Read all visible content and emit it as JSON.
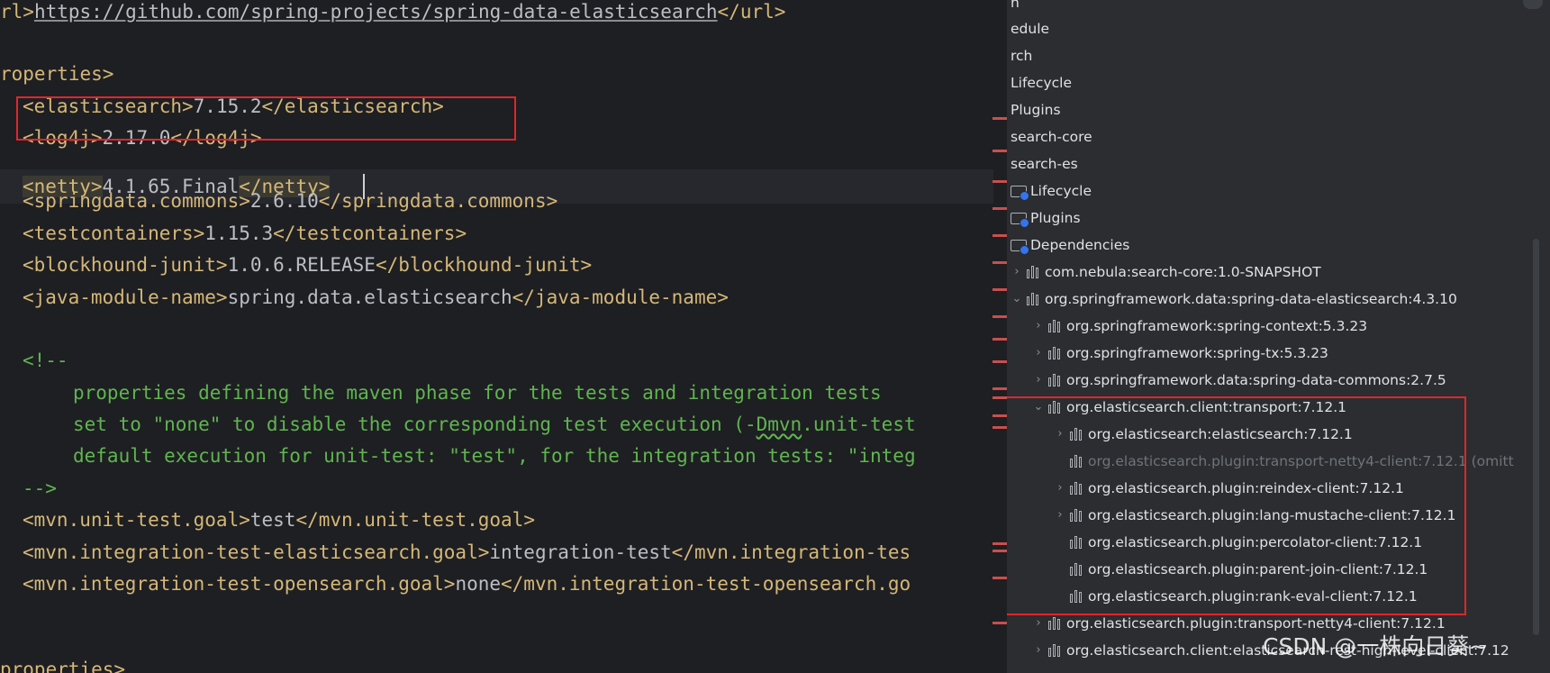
{
  "editor": {
    "line_url": {
      "open": "rl>",
      "url": "https://github.com/spring-projects/spring-data-elasticsearch",
      "close": "</url>"
    },
    "line_properties_open": "roperties>",
    "line_elasticsearch": {
      "open": "<elasticsearch>",
      "value": "7.15.2",
      "close": "</elasticsearch>"
    },
    "line_log4j": {
      "open": "<log4j>",
      "value": "2.17.0",
      "close": "</log4j>"
    },
    "line_netty": {
      "open": "<netty>",
      "value": "4.1.65.Final",
      "close": "</netty>"
    },
    "line_springdata": {
      "open": "<springdata.commons>",
      "value": "2.6.10",
      "close": "</springdata.commons>"
    },
    "line_testcontainers": {
      "open": "<testcontainers>",
      "value": "1.15.3",
      "close": "</testcontainers>"
    },
    "line_blockhound": {
      "open": "<blockhound-junit>",
      "value": "1.0.6.RELEASE",
      "close": "</blockhound-junit>"
    },
    "line_javamodule": {
      "open": "<java-module-name>",
      "value": "spring.data.elasticsearch",
      "close": "</java-module-name>"
    },
    "comment_open": "<!--",
    "comment_1": "properties defining the maven phase for the tests and integration tests",
    "comment_2a": "set to \"none\" to disable the corresponding test execution (-",
    "comment_2b": "Dmvn",
    "comment_2c": ".unit-test",
    "comment_3": "default execution for unit-test: \"test\", for the integration tests: \"integ",
    "comment_close": "-->",
    "line_unit_goal": {
      "open": "<mvn.unit-test.goal>",
      "value": "test",
      "close": "</mvn.unit-test.goal>"
    },
    "line_it_es": {
      "open": "<mvn.integration-test-elasticsearch.goal>",
      "value": "integration-test",
      "close": "</mvn.integration-tes"
    },
    "line_it_os": {
      "open": "<mvn.integration-test-opensearch.goal>",
      "value": "none",
      "close": "</mvn.integration-test-opensearch.go"
    },
    "line_properties_close": "properties>"
  },
  "panel": {
    "top_items": [
      "n",
      "edule",
      "rch",
      "Lifecycle",
      "Plugins",
      "search-core",
      "search-es"
    ],
    "folders": [
      "Lifecycle",
      "Plugins",
      "Dependencies"
    ],
    "deps": [
      {
        "label": "com.nebula:search-core:1.0-SNAPSHOT",
        "chevron": "›"
      },
      {
        "label": "org.springframework.data:spring-data-elasticsearch:4.3.10",
        "chevron": "⌄"
      },
      {
        "label": "org.springframework:spring-context:5.3.23",
        "chevron": "›"
      },
      {
        "label": "org.springframework:spring-tx:5.3.23",
        "chevron": "›"
      },
      {
        "label": "org.springframework.data:spring-data-commons:2.7.5",
        "chevron": "›"
      },
      {
        "label": "org.elasticsearch.client:transport:7.12.1",
        "chevron": "⌄"
      },
      {
        "label": "org.elasticsearch:elasticsearch:7.12.1",
        "chevron": "›"
      },
      {
        "label": "org.elasticsearch.plugin:transport-netty4-client:7.12.1 (omitt",
        "chevron": ""
      },
      {
        "label": "org.elasticsearch.plugin:reindex-client:7.12.1",
        "chevron": "›"
      },
      {
        "label": "org.elasticsearch.plugin:lang-mustache-client:7.12.1",
        "chevron": "›"
      },
      {
        "label": "org.elasticsearch.plugin:percolator-client:7.12.1",
        "chevron": ""
      },
      {
        "label": "org.elasticsearch.plugin:parent-join-client:7.12.1",
        "chevron": ""
      },
      {
        "label": "org.elasticsearch.plugin:rank-eval-client:7.12.1",
        "chevron": ""
      },
      {
        "label": "org.elasticsearch.plugin:transport-netty4-client:7.12.1",
        "chevron": "›"
      },
      {
        "label": "org.elasticsearch.client:elasticsearch-rest-high-level-client:7.12",
        "chevron": "›"
      }
    ]
  },
  "watermark": "CSDN @一株向日葵~",
  "colors": {
    "highlight_box": "#e0262b",
    "tag": "#d5b778",
    "comment": "#5fb550",
    "folder_badge": "#3574f0"
  }
}
